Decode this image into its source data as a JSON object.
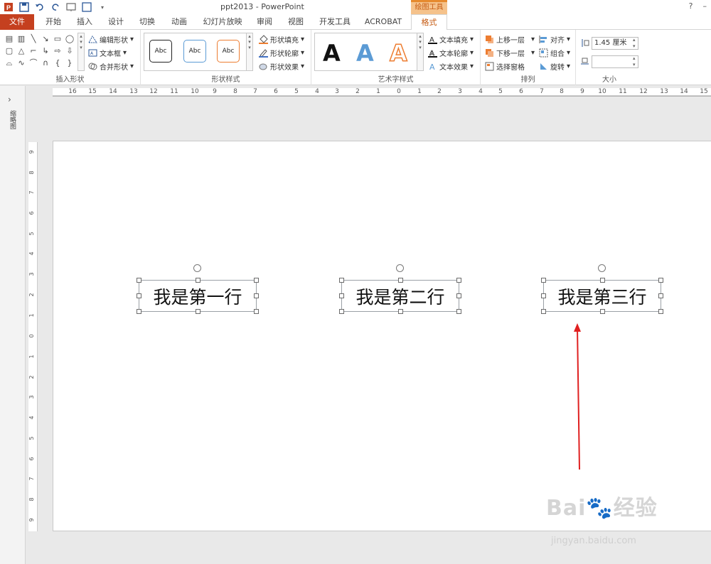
{
  "window": {
    "title": "ppt2013 - PowerPoint",
    "context_tab_header": "绘图工具",
    "help": "?",
    "min": "–"
  },
  "tabs": [
    {
      "label": "文件"
    },
    {
      "label": "开始"
    },
    {
      "label": "插入"
    },
    {
      "label": "设计"
    },
    {
      "label": "切换"
    },
    {
      "label": "动画"
    },
    {
      "label": "幻灯片放映"
    },
    {
      "label": "审阅"
    },
    {
      "label": "视图"
    },
    {
      "label": "开发工具"
    },
    {
      "label": "ACROBAT"
    },
    {
      "label": "格式"
    }
  ],
  "ribbon": {
    "insert_shapes": {
      "label": "插入形状",
      "edit_shape": "编辑形状",
      "text_box": "文本框",
      "merge_shapes": "合并形状"
    },
    "shape_styles": {
      "label": "形状样式",
      "sample": "Abc",
      "fill": "形状填充",
      "outline": "形状轮廓",
      "effects": "形状效果"
    },
    "wordart": {
      "label": "艺术字样式",
      "letter": "A",
      "text_fill": "文本填充",
      "text_outline": "文本轮廓",
      "text_effects": "文本效果"
    },
    "arrange": {
      "label": "排列",
      "bring_forward": "上移一层",
      "send_backward": "下移一层",
      "selection_pane": "选择窗格",
      "align": "对齐",
      "group": "组合",
      "rotate": "旋转"
    },
    "size": {
      "label": "大小",
      "height_value": "1.45 厘米",
      "width_value": ""
    }
  },
  "left_pane": {
    "label": "缩略图"
  },
  "slide": {
    "boxes": [
      {
        "text": "我是第一行"
      },
      {
        "text": "我是第二行"
      },
      {
        "text": "我是第三行"
      }
    ]
  },
  "watermark": {
    "main": "Bai🐾经验",
    "sub": "jingyan.baidu.com"
  },
  "colors": {
    "accent": "#c5401f",
    "context": "#e68a2e",
    "arrow": "#e02020"
  }
}
